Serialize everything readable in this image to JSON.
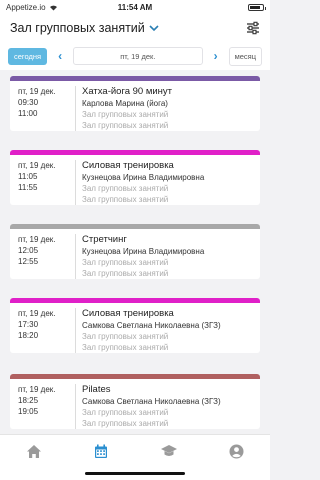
{
  "status": {
    "carrier": "Appetize.io",
    "time": "11:54 AM"
  },
  "header": {
    "title": "Зал групповых занятий"
  },
  "datebar": {
    "today": "сегодня",
    "date": "пт, 19 дек.",
    "month": "месяц"
  },
  "events": [
    {
      "color": "#7b5aa6",
      "date": "пт, 19 дек.",
      "start": "09:30",
      "end": "11:00",
      "name": "Хатха-йога 90 минут",
      "teacher": "Карлова Марина (йога)",
      "hall1": "Зал групповых занятий",
      "hall2": "Зал групповых занятий"
    },
    {
      "color": "#e020c8",
      "date": "пт, 19 дек.",
      "start": "11:05",
      "end": "11:55",
      "name": "Силовая тренировка",
      "teacher": "Кузнецова Ирина Владимировна",
      "hall1": "Зал групповых занятий",
      "hall2": "Зал групповых занятий"
    },
    {
      "color": "#a8a8a8",
      "date": "пт, 19 дек.",
      "start": "12:05",
      "end": "12:55",
      "name": "Стретчинг",
      "teacher": "Кузнецова Ирина Владимировна",
      "hall1": "Зал групповых занятий",
      "hall2": "Зал групповых занятий"
    },
    {
      "color": "#e020c8",
      "date": "пт, 19 дек.",
      "start": "17:30",
      "end": "18:20",
      "name": "Силовая тренировка",
      "teacher": "Самкова Светлана Николаевна (ЗГЗ)",
      "hall1": "Зал групповых занятий",
      "hall2": "Зал групповых занятий"
    },
    {
      "color": "#b06060",
      "date": "пт, 19 дек.",
      "start": "18:25",
      "end": "19:05",
      "name": "Pilates",
      "teacher": "Самкова Светлана Николаевна (ЗГЗ)",
      "hall1": "Зал групповых занятий",
      "hall2": "Зал групповых занятий"
    }
  ],
  "tabs": [
    {
      "icon": "home-icon",
      "active": false
    },
    {
      "icon": "calendar-icon",
      "active": true
    },
    {
      "icon": "graduation-cap-icon",
      "active": false
    },
    {
      "icon": "profile-icon",
      "active": false
    }
  ],
  "colors": {
    "accent": "#2b8fd0",
    "inactive_tab": "#9a9a9a",
    "today_button": "#5fb8e1"
  }
}
